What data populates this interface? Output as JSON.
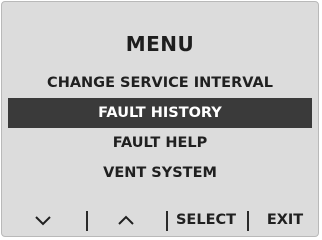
{
  "menu": {
    "title": "MENU",
    "items": [
      {
        "label": "CHANGE SERVICE INTERVAL",
        "selected": false
      },
      {
        "label": "FAULT HISTORY",
        "selected": true
      },
      {
        "label": "FAULT HELP",
        "selected": false
      },
      {
        "label": "VENT SYSTEM",
        "selected": false
      }
    ]
  },
  "softkeys": {
    "down_icon": "chevron-down-icon",
    "up_icon": "chevron-up-icon",
    "select_label": "SELECT",
    "exit_label": "EXIT"
  },
  "colors": {
    "screen_background": "#dcdcdc",
    "highlight_background": "#3a3a3a",
    "highlight_text": "#ffffff",
    "text": "#202020"
  }
}
